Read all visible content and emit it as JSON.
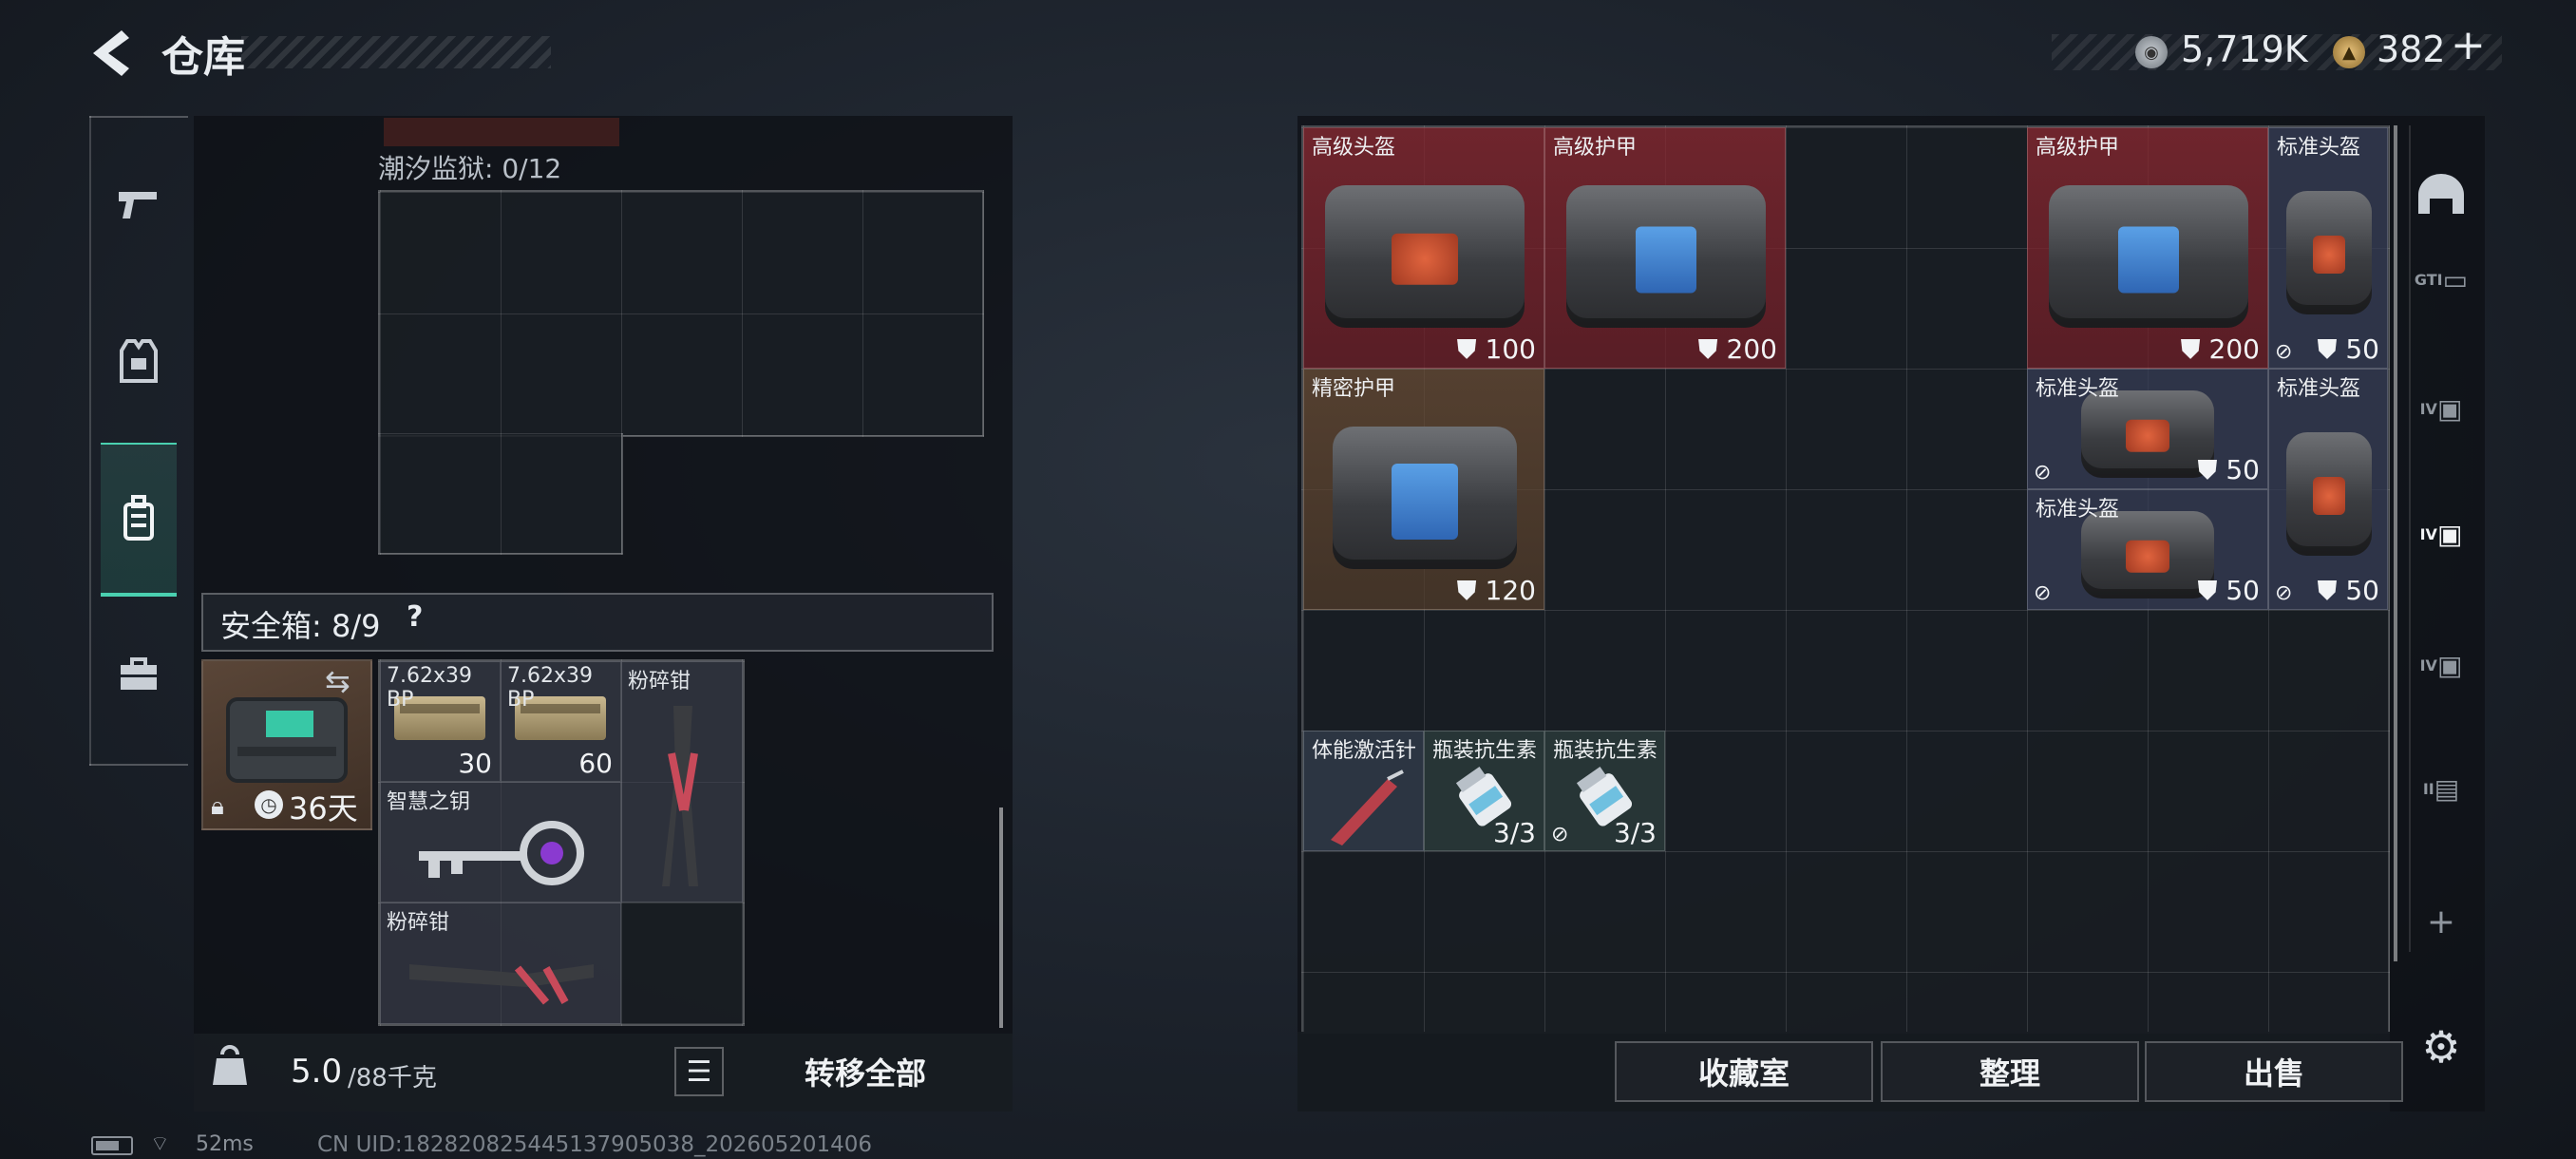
{
  "header": {
    "back_icon": "back-arrow-icon",
    "title": "仓库",
    "currency1": {
      "icon": "silver-coin-icon",
      "value": "5,719K"
    },
    "currency2": {
      "icon": "gold-coin-icon",
      "value": "382",
      "plus": "+"
    }
  },
  "nav": {
    "items": [
      {
        "icon": "gun-icon"
      },
      {
        "icon": "vest-icon"
      },
      {
        "icon": "backpack-icon",
        "active": true
      },
      {
        "icon": "briefcase-icon"
      }
    ]
  },
  "left": {
    "tidal_label": "潮汐监狱: 0/12",
    "safe_label": "安全箱: 8/9",
    "safe_help": "?",
    "safe_days": "36天",
    "items": [
      {
        "label": "7.62x39 BP",
        "count": "30"
      },
      {
        "label": "7.62x39 BP",
        "count": "60"
      },
      {
        "label": "粉碎钳",
        "count": ""
      },
      {
        "label": "智慧之钥",
        "count": ""
      },
      {
        "label": "粉碎钳",
        "count": ""
      }
    ],
    "weight_value": "5.0",
    "weight_unit": "/88千克",
    "transfer_label": "转移全部"
  },
  "right": {
    "items": [
      {
        "label": "高级头盔",
        "armor": "100"
      },
      {
        "label": "高级护甲",
        "armor": "200"
      },
      {
        "label": "高级护甲",
        "armor": "200"
      },
      {
        "label": "标准头盔",
        "armor": "50"
      },
      {
        "label": "精密护甲",
        "armor": "120"
      },
      {
        "label": "标准头盔",
        "armor": "50"
      },
      {
        "label": "标准头盔",
        "armor": "50"
      },
      {
        "label": "标准头盔",
        "armor": "50"
      },
      {
        "label": "体能激活针",
        "count": ""
      },
      {
        "label": "瓶装抗生素",
        "count": "3/3"
      },
      {
        "label": "瓶装抗生素",
        "count": "3/3"
      }
    ],
    "buttons": {
      "collection": "收藏室",
      "sort": "整理",
      "sell": "出售"
    }
  },
  "side_icons": [
    "helmet-icon",
    "gti-card-icon",
    "iv-medkit-icon",
    "iv-medkit-add-icon",
    "iv-medkit-icon",
    "ii-container-icon",
    "plus-icon",
    "gear-icon"
  ],
  "side_labels": {
    "gti": "GTI",
    "iv": "IV",
    "ii": "II",
    "plus": "+"
  },
  "status": {
    "ping": "52ms",
    "uid": "CN UID:182820825445137905038_202605201406"
  },
  "colors": {
    "accent_teal": "#4ad0b0",
    "rare_red": "#8c2830",
    "epic_brown": "#6e4e36",
    "standard_blue": "#363c56"
  }
}
